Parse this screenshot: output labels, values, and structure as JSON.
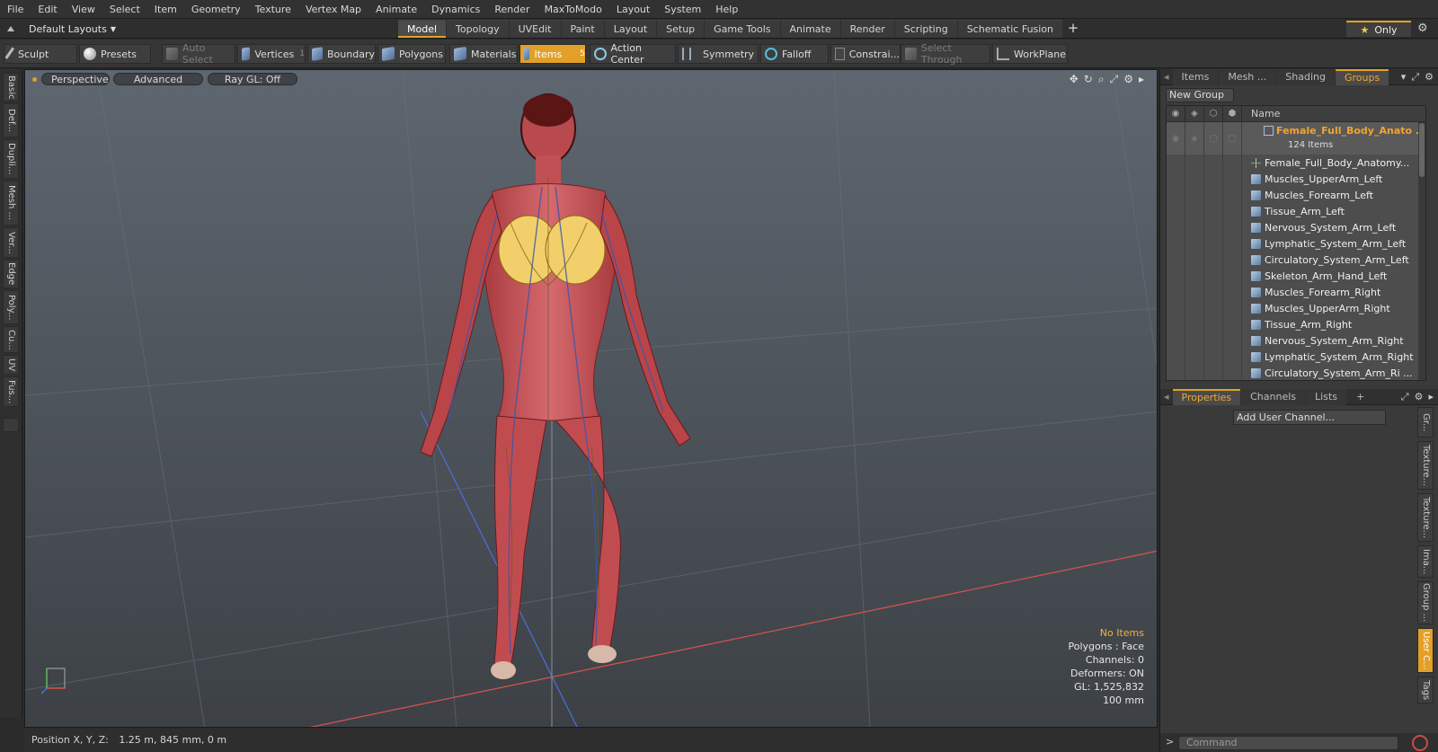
{
  "menubar": {
    "items": [
      "File",
      "Edit",
      "View",
      "Select",
      "Item",
      "Geometry",
      "Texture",
      "Vertex Map",
      "Animate",
      "Dynamics",
      "Render",
      "MaxToModo",
      "Layout",
      "System",
      "Help"
    ]
  },
  "layoutbar": {
    "layout_selector": "Default Layouts",
    "tabs": [
      "Model",
      "Topology",
      "UVEdit",
      "Paint",
      "Layout",
      "Setup",
      "Game Tools",
      "Animate",
      "Render",
      "Scripting",
      "Schematic Fusion"
    ],
    "active_tab": "Model",
    "only_label": "Only"
  },
  "toolbar": {
    "sculpt": "Sculpt",
    "presets": "Presets",
    "auto_select": "Auto Select",
    "vertices": "Vertices",
    "vertices_count": "1",
    "boundary": "Boundary",
    "polygons": "Polygons",
    "materials": "Materials",
    "items": "Items",
    "items_count": "5",
    "action_center": "Action Center",
    "symmetry": "Symmetry",
    "falloff": "Falloff",
    "constraints": "Constrai...",
    "select_through": "Select Through",
    "workplane": "WorkPlane"
  },
  "left_tabs": [
    "Basic",
    "Def...",
    "Dupli...",
    "Mesh ...",
    "Ver...",
    "Edge",
    "Poly...",
    "Cu...",
    "UV",
    "Fus..."
  ],
  "viewport": {
    "view_mode": "Perspective",
    "advanced": "Advanced",
    "raygl": "Ray GL: Off",
    "hud": {
      "selection": "No Items",
      "polygons": "Polygons : Face",
      "channels": "Channels: 0",
      "deformers": "Deformers: ON",
      "gl": "GL: 1,525,832",
      "scale": "100 mm"
    },
    "colors": {
      "accent": "#e2a028",
      "grid_x_axis": "#d9534f",
      "grid_z_axis": "#4a6fe0"
    }
  },
  "statusbar": {
    "label": "Position X, Y, Z:",
    "value": "1.25 m, 845 mm, 0 m"
  },
  "item_panel": {
    "tabs": [
      "Items",
      "Mesh ...",
      "Shading",
      "Groups"
    ],
    "active_tab": "Groups",
    "new_group": "New Group",
    "column_name": "Name",
    "group": {
      "name": "Female_Full_Body_Anato ...",
      "count": "124 Items"
    },
    "rows": [
      {
        "label": "Female_Full_Body_Anatomy...",
        "icon": "locator-icon"
      },
      {
        "label": "Muscles_UpperArm_Left",
        "icon": "mesh-icon"
      },
      {
        "label": "Muscles_Forearm_Left",
        "icon": "mesh-icon"
      },
      {
        "label": "Tissue_Arm_Left",
        "icon": "mesh-icon"
      },
      {
        "label": "Nervous_System_Arm_Left",
        "icon": "mesh-icon"
      },
      {
        "label": "Lymphatic_System_Arm_Left",
        "icon": "mesh-icon"
      },
      {
        "label": "Circulatory_System_Arm_Left",
        "icon": "mesh-icon"
      },
      {
        "label": "Skeleton_Arm_Hand_Left",
        "icon": "mesh-icon"
      },
      {
        "label": "Muscles_Forearm_Right",
        "icon": "mesh-icon"
      },
      {
        "label": "Muscles_UpperArm_Right",
        "icon": "mesh-icon"
      },
      {
        "label": "Tissue_Arm_Right",
        "icon": "mesh-icon"
      },
      {
        "label": "Nervous_System_Arm_Right",
        "icon": "mesh-icon"
      },
      {
        "label": "Lymphatic_System_Arm_Right",
        "icon": "mesh-icon"
      },
      {
        "label": "Circulatory_System_Arm_Ri ...",
        "icon": "mesh-icon"
      }
    ]
  },
  "properties_panel": {
    "tabs": [
      "Properties",
      "Channels",
      "Lists"
    ],
    "active_tab": "Properties",
    "add_user_channel": "Add User Channel...",
    "side_tabs": [
      "Gr...",
      "Texture...",
      "Texture...",
      "Ima...",
      "Group ...",
      "User C...",
      "Tags"
    ],
    "active_side_tab": "User C..."
  },
  "command": {
    "prompt": ">",
    "placeholder": "Command"
  }
}
